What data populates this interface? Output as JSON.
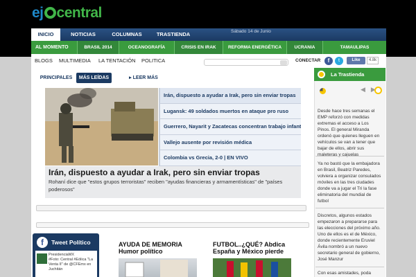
{
  "logo": {
    "part1": "ej",
    "part2": "central"
  },
  "nav_main": {
    "items": [
      "INICIO",
      "NOTICIAS",
      "COLUMNAS",
      "TRASTIENDA"
    ],
    "date": "Sábado 14 de Junio"
  },
  "nav_topics": [
    "AL MOMENTO",
    "BRASIL 2014",
    "OCEANOGRAFÍA",
    "CRISIS EN IRAK",
    "REFORMA ENERGÉTICA",
    "UCRANIA",
    "TAMAULIPAS"
  ],
  "nav_secondary": [
    "BLOGS",
    "MULTIMEDIA",
    "LA TENTACIÓN",
    "POLITICA"
  ],
  "social": {
    "connect_label": "CONECTAR",
    "facebook_glyph": "f",
    "twitter_glyph": "t",
    "like_label": "Like",
    "like_count": "4.8k"
  },
  "tabs": [
    "PRINCIPALES",
    "MÁS LEÍDAS",
    "LEER MÁS"
  ],
  "headlines": [
    "Irán, dispuesto a ayudar a Irak, pero sin enviar tropas",
    "Lugansk: 49 soldados muertos en ataque pro ruso",
    "Guerrero, Nayarit y Zacatecas concentran trabajo infantil",
    "Vallejo ausente por revisión médica",
    "Colombia vs Grecia, 2-0 | EN VIVO"
  ],
  "featured": {
    "title": "Irán, dispuesto a ayudar a Irak, pero sin enviar tropas",
    "subtitle": "Rohaní dice que \"estos grupos terroristas\" reciben \"ayudas financieras y armamentísticas\" de \"países poderosos\""
  },
  "sidebar": {
    "title": "La Trastienda",
    "controls": [
      "◀",
      "▶"
    ],
    "items": [
      "Desde hace tres semanas el EMP reforzó con medidas extremas el acceso a Los Pinos. El general Miranda ordenó que quienes lleguen en vehículos se van a tener que bajar de ellos, abrir sus maleteras y cajuelas",
      "Ya no bastó que la embajadora en Brasil, Beatriz Paredes, volviera a organizar consulados móviles en las tres ciudades donde va a jugar el Tri la fase eliminatoria del mundial de futbol",
      "Discretos, algunos estados empezaron a prepararse para las elecciones del próximo año. Uno de ellos es el de México, donde recientemente Eruviel Ávila nombró a un nuevo secretario general de gobierno, José Manzur",
      "Con esas amistades, poda"
    ]
  },
  "tweet_widget": {
    "title": "Tweet Político",
    "user": "PresidenciaMX",
    "text": "#Foto: Central #Eólica \"La Venta II\" de @CFEmx en Juchitán"
  },
  "articles": [
    {
      "title": "AYUDA DE MEMORIA\nHumor político"
    },
    {
      "title": "FUTBOL..¿QUÉ? Abdica\nEspaña y México pierde"
    }
  ],
  "colors": {
    "navy": "#1b3a62",
    "green": "#3a9b3e",
    "logo_blue": "#1e88c8",
    "logo_green": "#41b649",
    "accent_yellow": "#f7c600"
  }
}
